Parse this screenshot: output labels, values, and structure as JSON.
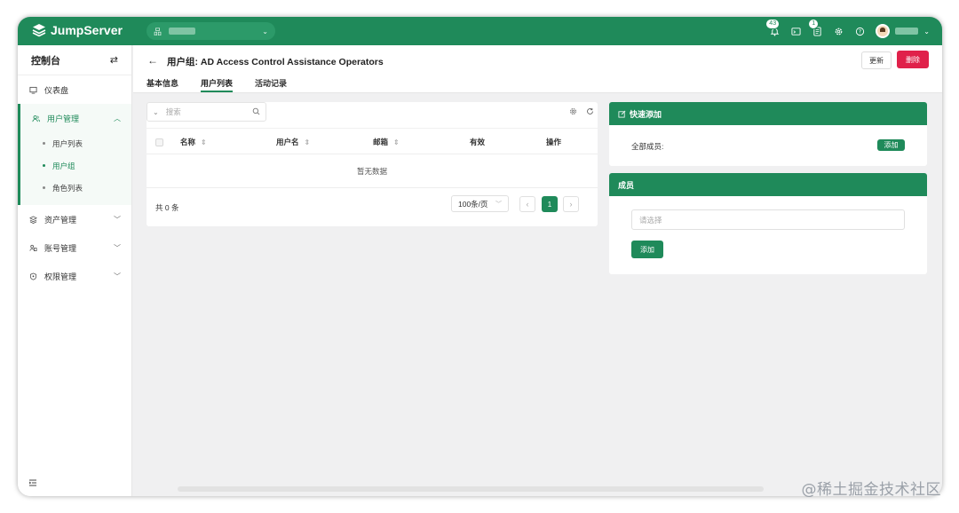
{
  "app": {
    "name": "JumpServer",
    "brand_color": "#1f8a5a",
    "danger_color": "#e0214a"
  },
  "topbar": {
    "org_icon": "org-icon",
    "notifications_badge": "43",
    "tickets_badge": "1",
    "icons": [
      "bell-icon",
      "terminal-icon",
      "ticket-icon",
      "gear-icon",
      "help-icon"
    ]
  },
  "sidebar": {
    "title": "控制台",
    "items": [
      {
        "label": "仪表盘",
        "icon": "dashboard-icon"
      },
      {
        "label": "用户管理",
        "icon": "users-icon"
      },
      {
        "label": "资产管理",
        "icon": "assets-icon"
      },
      {
        "label": "账号管理",
        "icon": "accounts-icon"
      },
      {
        "label": "权限管理",
        "icon": "permissions-icon"
      }
    ],
    "sub_items": [
      {
        "label": "用户列表"
      },
      {
        "label": "用户组"
      },
      {
        "label": "角色列表"
      }
    ]
  },
  "header": {
    "title": "用户组: AD Access Control Assistance Operators",
    "update_label": "更新",
    "delete_label": "删除",
    "tabs": [
      {
        "label": "基本信息"
      },
      {
        "label": "用户列表"
      },
      {
        "label": "活动记录"
      }
    ]
  },
  "table": {
    "search_placeholder": "搜索",
    "columns": [
      "名称",
      "用户名",
      "邮箱",
      "有效",
      "操作"
    ],
    "empty_text": "暂无数据",
    "total_text": "共 0 条",
    "page_size": "100条/页",
    "current_page": "1"
  },
  "quick_add": {
    "title": "快速添加",
    "row_label": "全部成员:",
    "add_label": "添加"
  },
  "members": {
    "title": "成员",
    "select_placeholder": "请选择",
    "add_label": "添加"
  },
  "watermark": "@稀土掘金技术社区"
}
